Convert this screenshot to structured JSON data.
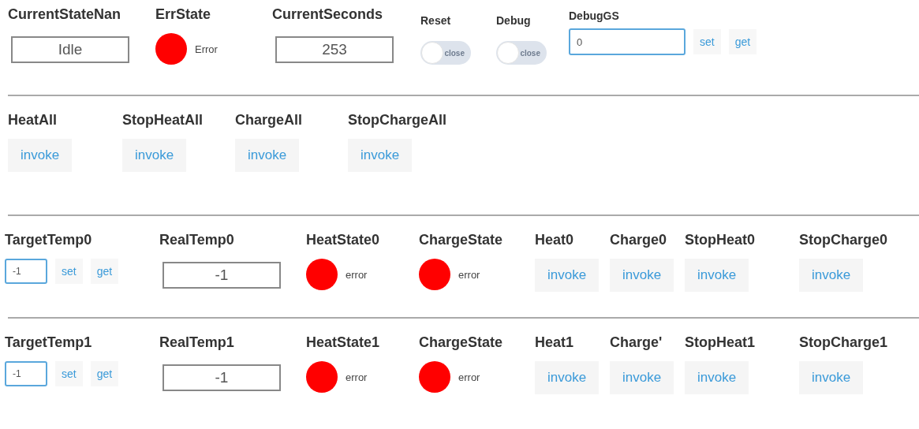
{
  "sections": [
    {
      "kind": "top",
      "widgets": [
        {
          "kind": "textbox",
          "label": "CurrentStateNan",
          "value": "Idle"
        },
        {
          "kind": "status",
          "label": "ErrState",
          "color": "#ff0000",
          "text": "Error"
        },
        {
          "kind": "textbox",
          "label": "CurrentSeconds",
          "value": "253"
        },
        {
          "kind": "toggle",
          "label": "Reset",
          "on": false,
          "track_text": "close"
        },
        {
          "kind": "toggle",
          "label": "Debug",
          "on": false,
          "track_text": "close"
        },
        {
          "kind": "input",
          "label": "DebugGS",
          "value": "0",
          "buttons": [
            "set",
            "get"
          ]
        }
      ]
    },
    {
      "kind": "actions",
      "widgets": [
        {
          "kind": "invoke",
          "label": "HeatAll",
          "button": "invoke"
        },
        {
          "kind": "invoke",
          "label": "StopHeatAll",
          "button": "invoke"
        },
        {
          "kind": "invoke",
          "label": "ChargeAll",
          "button": "invoke"
        },
        {
          "kind": "invoke",
          "label": "StopChargeAll",
          "button": "invoke"
        }
      ]
    },
    {
      "kind": "channel",
      "widgets": [
        {
          "kind": "input",
          "label": "TargetTemp0",
          "value": "-1",
          "buttons": [
            "set",
            "get"
          ]
        },
        {
          "kind": "textbox",
          "label": "RealTemp0",
          "value": "-1"
        },
        {
          "kind": "status",
          "label": "HeatState0",
          "color": "#ff0000",
          "text": "error"
        },
        {
          "kind": "status",
          "label": "ChargeState",
          "color": "#ff0000",
          "text": "error"
        },
        {
          "kind": "invoke",
          "label": "Heat0",
          "button": "invoke"
        },
        {
          "kind": "invoke",
          "label": "Charge0",
          "button": "invoke"
        },
        {
          "kind": "invoke",
          "label": "StopHeat0",
          "button": "invoke"
        },
        {
          "kind": "invoke",
          "label": "StopCharge0",
          "button": "invoke"
        }
      ]
    },
    {
      "kind": "channel",
      "widgets": [
        {
          "kind": "input",
          "label": "TargetTemp1",
          "value": "-1",
          "buttons": [
            "set",
            "get"
          ]
        },
        {
          "kind": "textbox",
          "label": "RealTemp1",
          "value": "-1"
        },
        {
          "kind": "status",
          "label": "HeatState1",
          "color": "#ff0000",
          "text": "error"
        },
        {
          "kind": "status",
          "label": "ChargeState",
          "color": "#ff0000",
          "text": "error"
        },
        {
          "kind": "invoke",
          "label": "Heat1",
          "button": "invoke"
        },
        {
          "kind": "invoke",
          "label": "Charge'",
          "button": "invoke"
        },
        {
          "kind": "invoke",
          "label": "StopHeat1",
          "button": "invoke"
        },
        {
          "kind": "invoke",
          "label": "StopCharge1",
          "button": "invoke"
        }
      ]
    }
  ]
}
